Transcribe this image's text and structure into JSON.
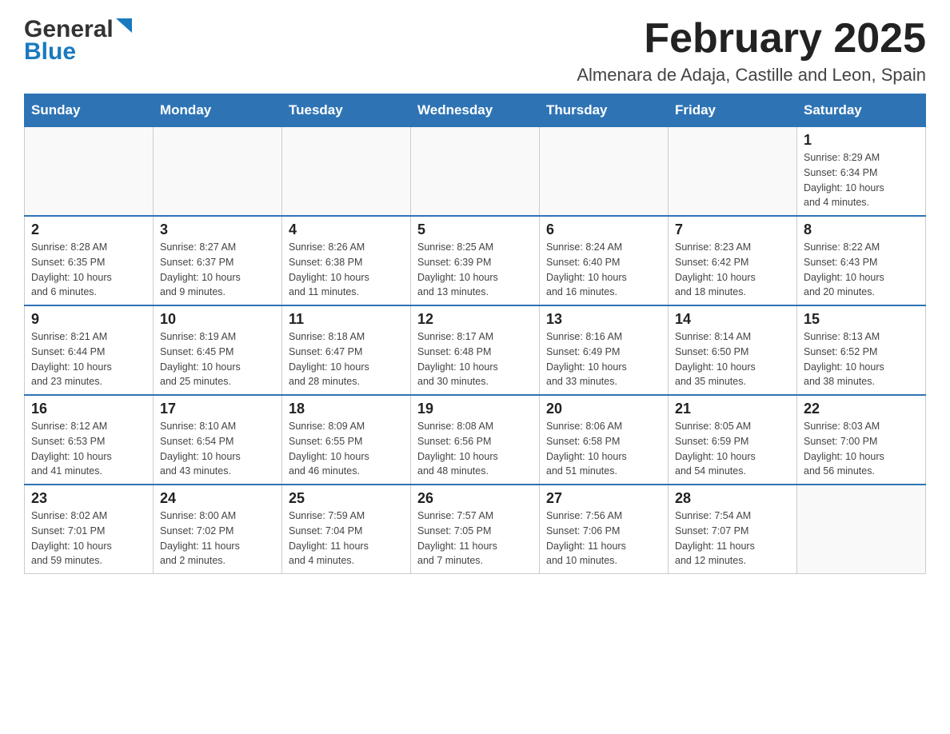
{
  "header": {
    "logo_general": "General",
    "logo_blue": "Blue",
    "month_title": "February 2025",
    "location": "Almenara de Adaja, Castille and Leon, Spain"
  },
  "weekdays": [
    "Sunday",
    "Monday",
    "Tuesday",
    "Wednesday",
    "Thursday",
    "Friday",
    "Saturday"
  ],
  "weeks": [
    [
      {
        "day": "",
        "info": ""
      },
      {
        "day": "",
        "info": ""
      },
      {
        "day": "",
        "info": ""
      },
      {
        "day": "",
        "info": ""
      },
      {
        "day": "",
        "info": ""
      },
      {
        "day": "",
        "info": ""
      },
      {
        "day": "1",
        "info": "Sunrise: 8:29 AM\nSunset: 6:34 PM\nDaylight: 10 hours\nand 4 minutes."
      }
    ],
    [
      {
        "day": "2",
        "info": "Sunrise: 8:28 AM\nSunset: 6:35 PM\nDaylight: 10 hours\nand 6 minutes."
      },
      {
        "day": "3",
        "info": "Sunrise: 8:27 AM\nSunset: 6:37 PM\nDaylight: 10 hours\nand 9 minutes."
      },
      {
        "day": "4",
        "info": "Sunrise: 8:26 AM\nSunset: 6:38 PM\nDaylight: 10 hours\nand 11 minutes."
      },
      {
        "day": "5",
        "info": "Sunrise: 8:25 AM\nSunset: 6:39 PM\nDaylight: 10 hours\nand 13 minutes."
      },
      {
        "day": "6",
        "info": "Sunrise: 8:24 AM\nSunset: 6:40 PM\nDaylight: 10 hours\nand 16 minutes."
      },
      {
        "day": "7",
        "info": "Sunrise: 8:23 AM\nSunset: 6:42 PM\nDaylight: 10 hours\nand 18 minutes."
      },
      {
        "day": "8",
        "info": "Sunrise: 8:22 AM\nSunset: 6:43 PM\nDaylight: 10 hours\nand 20 minutes."
      }
    ],
    [
      {
        "day": "9",
        "info": "Sunrise: 8:21 AM\nSunset: 6:44 PM\nDaylight: 10 hours\nand 23 minutes."
      },
      {
        "day": "10",
        "info": "Sunrise: 8:19 AM\nSunset: 6:45 PM\nDaylight: 10 hours\nand 25 minutes."
      },
      {
        "day": "11",
        "info": "Sunrise: 8:18 AM\nSunset: 6:47 PM\nDaylight: 10 hours\nand 28 minutes."
      },
      {
        "day": "12",
        "info": "Sunrise: 8:17 AM\nSunset: 6:48 PM\nDaylight: 10 hours\nand 30 minutes."
      },
      {
        "day": "13",
        "info": "Sunrise: 8:16 AM\nSunset: 6:49 PM\nDaylight: 10 hours\nand 33 minutes."
      },
      {
        "day": "14",
        "info": "Sunrise: 8:14 AM\nSunset: 6:50 PM\nDaylight: 10 hours\nand 35 minutes."
      },
      {
        "day": "15",
        "info": "Sunrise: 8:13 AM\nSunset: 6:52 PM\nDaylight: 10 hours\nand 38 minutes."
      }
    ],
    [
      {
        "day": "16",
        "info": "Sunrise: 8:12 AM\nSunset: 6:53 PM\nDaylight: 10 hours\nand 41 minutes."
      },
      {
        "day": "17",
        "info": "Sunrise: 8:10 AM\nSunset: 6:54 PM\nDaylight: 10 hours\nand 43 minutes."
      },
      {
        "day": "18",
        "info": "Sunrise: 8:09 AM\nSunset: 6:55 PM\nDaylight: 10 hours\nand 46 minutes."
      },
      {
        "day": "19",
        "info": "Sunrise: 8:08 AM\nSunset: 6:56 PM\nDaylight: 10 hours\nand 48 minutes."
      },
      {
        "day": "20",
        "info": "Sunrise: 8:06 AM\nSunset: 6:58 PM\nDaylight: 10 hours\nand 51 minutes."
      },
      {
        "day": "21",
        "info": "Sunrise: 8:05 AM\nSunset: 6:59 PM\nDaylight: 10 hours\nand 54 minutes."
      },
      {
        "day": "22",
        "info": "Sunrise: 8:03 AM\nSunset: 7:00 PM\nDaylight: 10 hours\nand 56 minutes."
      }
    ],
    [
      {
        "day": "23",
        "info": "Sunrise: 8:02 AM\nSunset: 7:01 PM\nDaylight: 10 hours\nand 59 minutes."
      },
      {
        "day": "24",
        "info": "Sunrise: 8:00 AM\nSunset: 7:02 PM\nDaylight: 11 hours\nand 2 minutes."
      },
      {
        "day": "25",
        "info": "Sunrise: 7:59 AM\nSunset: 7:04 PM\nDaylight: 11 hours\nand 4 minutes."
      },
      {
        "day": "26",
        "info": "Sunrise: 7:57 AM\nSunset: 7:05 PM\nDaylight: 11 hours\nand 7 minutes."
      },
      {
        "day": "27",
        "info": "Sunrise: 7:56 AM\nSunset: 7:06 PM\nDaylight: 11 hours\nand 10 minutes."
      },
      {
        "day": "28",
        "info": "Sunrise: 7:54 AM\nSunset: 7:07 PM\nDaylight: 11 hours\nand 12 minutes."
      },
      {
        "day": "",
        "info": ""
      }
    ]
  ]
}
